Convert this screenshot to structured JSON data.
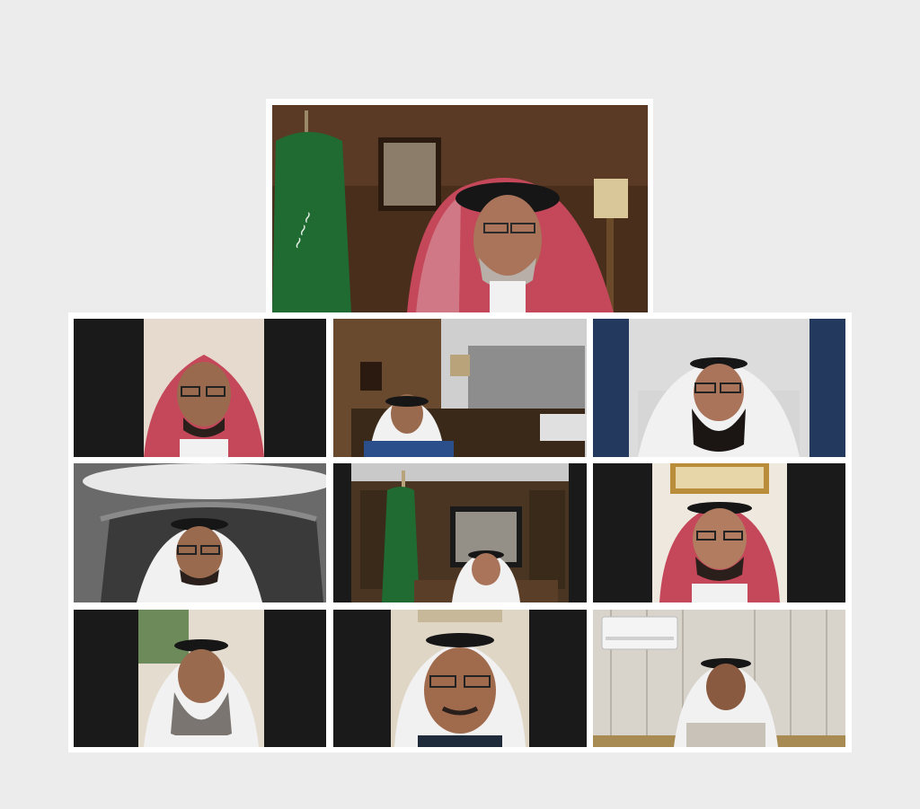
{
  "meeting": {
    "layout": "speaker-above-3x3-grid",
    "participant_count": 10,
    "speaker": {
      "id": "speaker",
      "backdrop": "office-with-flag",
      "headwear": "red-shemagh",
      "active": true
    },
    "tiles": [
      {
        "id": "p1",
        "backdrop": "light-wall",
        "headwear": "red-shemagh",
        "letterboxed": true
      },
      {
        "id": "p2",
        "backdrop": "office-desk",
        "headwear": "white-ghutra",
        "letterboxed": false
      },
      {
        "id": "p3",
        "backdrop": "curtains-armchair",
        "headwear": "white-ghutra",
        "letterboxed": false
      },
      {
        "id": "p4",
        "backdrop": "carved-headboard",
        "headwear": "white-ghutra",
        "letterboxed": false
      },
      {
        "id": "p5",
        "backdrop": "bookshelf-flag",
        "headwear": "white-ghutra",
        "letterboxed": true
      },
      {
        "id": "p6",
        "backdrop": "gold-frame",
        "headwear": "red-shemagh",
        "letterboxed": true
      },
      {
        "id": "p7",
        "backdrop": "window-plants",
        "headwear": "white-ghutra",
        "letterboxed": true
      },
      {
        "id": "p8",
        "backdrop": "light-room",
        "headwear": "white-ghutra",
        "letterboxed": true
      },
      {
        "id": "p9",
        "backdrop": "patterned-wall-ac",
        "headwear": "white-ghutra",
        "letterboxed": false
      }
    ]
  },
  "colors": {
    "page_bg": "#ececec",
    "frame": "#ffffff",
    "letterbox": "#1a1a1a",
    "shemagh_red": "#c4475a",
    "ghutra_white": "#f1f1f1",
    "agal_black": "#161616",
    "flag_green": "#1f6b32",
    "wood": "#4a2e1c"
  }
}
